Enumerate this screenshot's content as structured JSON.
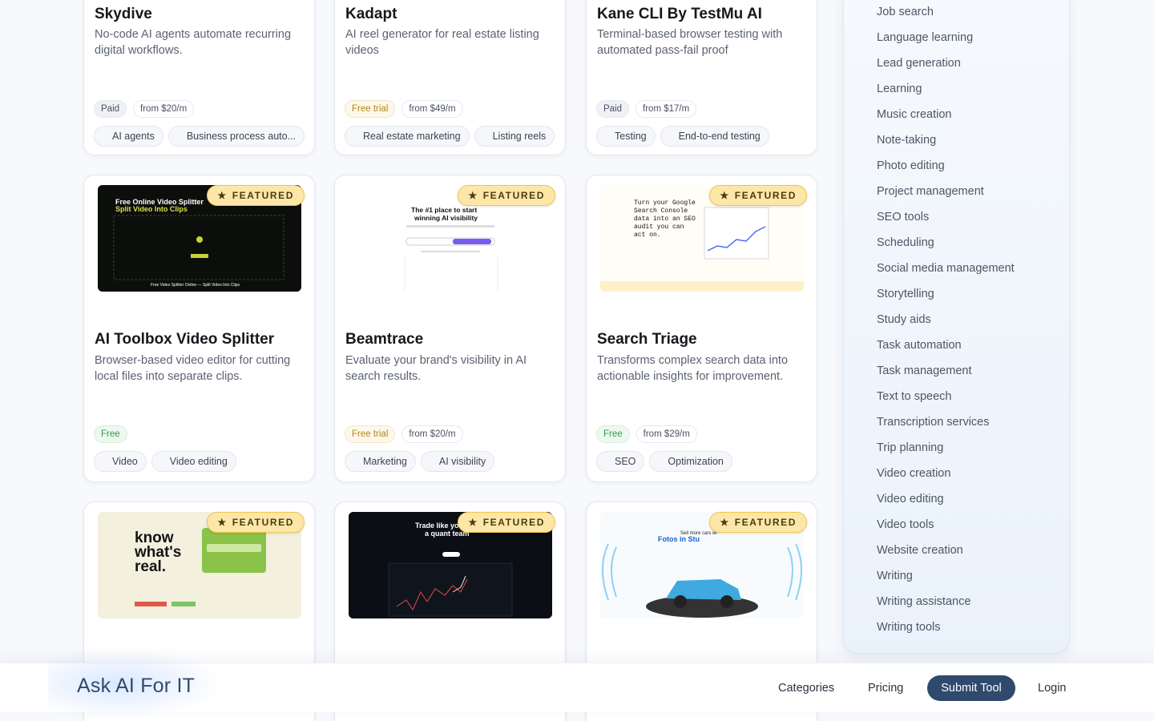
{
  "cards": [
    {
      "title": "Skydive",
      "desc": "No-code AI agents automate recurring digital workflows.",
      "badges": [
        "Paid",
        "from $20/m"
      ],
      "tags": [
        "AI agents",
        "Business process auto..."
      ]
    },
    {
      "title": "Kadapt",
      "desc": "AI reel generator for real estate listing videos",
      "badges": [
        "Free trial",
        "from $49/m"
      ],
      "tags": [
        "Real estate marketing",
        "Listing reels"
      ]
    },
    {
      "title": "Kane CLI By TestMu AI",
      "desc": "Terminal-based browser testing with automated pass-fail proof",
      "badges": [
        "Paid",
        "from $17/m"
      ],
      "tags": [
        "Testing",
        "End-to-end testing"
      ]
    },
    {
      "title": "AI Toolbox Video Splitter",
      "desc": "Browser-based video editor for cutting local files into separate clips.",
      "badges": [
        "Free"
      ],
      "tags": [
        "Video",
        "Video editing"
      ],
      "featured": "FEATURED",
      "thumb_text": [
        "Free Online Video Splitter",
        "Split Video Into Clips",
        "Free Video Splitter Online — Split Video Into Clips"
      ]
    },
    {
      "title": "Beamtrace",
      "desc": "Evaluate your brand's visibility in AI search results.",
      "badges": [
        "Free trial",
        "from $20/m"
      ],
      "tags": [
        "Marketing",
        "AI visibility"
      ],
      "featured": "FEATURED",
      "thumb_text": [
        "The #1 place to start",
        "winning AI visibility"
      ]
    },
    {
      "title": "Search Triage",
      "desc": "Transforms complex search data into actionable insights for improvement.",
      "badges": [
        "Free",
        "from $29/m"
      ],
      "tags": [
        "SEO",
        "Optimization"
      ],
      "featured": "FEATURED",
      "thumb_text": [
        "Turn your Google",
        "Search Console",
        "data into an SEO",
        "audit you can",
        "act on."
      ]
    },
    {
      "featured": "FEATURED",
      "thumb_text": [
        "know",
        "what's",
        "real."
      ]
    },
    {
      "featured": "FEATURED",
      "thumb_text": [
        "Trade like yo",
        "a quant team"
      ]
    },
    {
      "featured": "FEATURED",
      "thumb_text": [
        "Sell more cars wi",
        "Fotos in Stu"
      ]
    }
  ],
  "sidebar": {
    "items": [
      "Job search",
      "Language learning",
      "Lead generation",
      "Learning",
      "Music creation",
      "Note-taking",
      "Photo editing",
      "Project management",
      "SEO tools",
      "Scheduling",
      "Social media management",
      "Storytelling",
      "Study aids",
      "Task automation",
      "Task management",
      "Text to speech",
      "Transcription services",
      "Trip planning",
      "Video creation",
      "Video editing",
      "Video tools",
      "Website creation",
      "Writing",
      "Writing assistance",
      "Writing tools"
    ]
  },
  "nav": {
    "logo": "Ask AI For IT",
    "categories": "Categories",
    "pricing": "Pricing",
    "submit": "Submit Tool",
    "login": "Login"
  },
  "colors": {
    "accent": "#2f4a6d",
    "featured_bg": "#fde7a8"
  }
}
